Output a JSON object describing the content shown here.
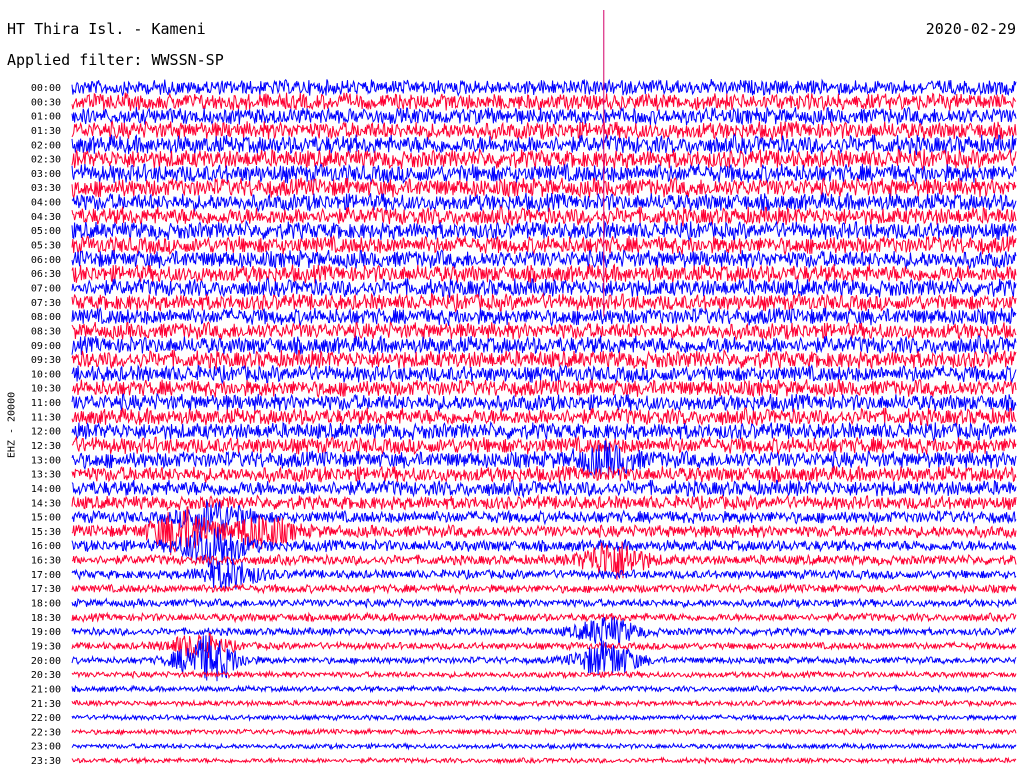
{
  "header": {
    "station": "HT Thira Isl. - Kameni",
    "date": "2020-02-29",
    "filter_label": "Applied filter: WWSSN-SP"
  },
  "colors": {
    "trace_a": "#0000ff",
    "trace_b": "#ff0033",
    "marker": "#d4006a"
  },
  "chart_data": {
    "type": "line",
    "title": "HT Thira Isl. - Kameni",
    "date": "2020-02-29",
    "filter": "WWSSN-SP",
    "ylabel": "EHZ - 20000",
    "row_labels": [
      "00:00",
      "00:30",
      "01:00",
      "01:30",
      "02:00",
      "02:30",
      "03:00",
      "03:30",
      "04:00",
      "04:30",
      "05:00",
      "05:30",
      "06:00",
      "06:30",
      "07:00",
      "07:30",
      "08:00",
      "08:30",
      "09:00",
      "09:30",
      "10:00",
      "10:30",
      "11:00",
      "11:30",
      "12:00",
      "12:30",
      "13:00",
      "13:30",
      "14:00",
      "14:30",
      "15:00",
      "15:30",
      "16:00",
      "16:30",
      "17:00",
      "17:30",
      "18:00",
      "18:30",
      "19:00",
      "19:30",
      "20:00",
      "20:30",
      "21:00",
      "21:30",
      "22:00",
      "22:30",
      "23:00",
      "23:30"
    ],
    "series_colors": [
      "#0000ff",
      "#ff0033"
    ],
    "minutes_per_row": 30,
    "relative_noise_amplitude": [
      0.78,
      0.85,
      0.85,
      0.9,
      0.95,
      0.95,
      0.95,
      0.95,
      0.9,
      0.9,
      0.9,
      0.9,
      0.9,
      0.9,
      0.9,
      0.85,
      0.85,
      0.85,
      0.9,
      0.9,
      0.85,
      0.85,
      0.85,
      0.85,
      0.85,
      0.85,
      0.85,
      0.8,
      0.8,
      0.7,
      0.62,
      0.62,
      0.58,
      0.5,
      0.45,
      0.42,
      0.4,
      0.4,
      0.38,
      0.36,
      0.34,
      0.3,
      0.28,
      0.27,
      0.26,
      0.26,
      0.25,
      0.25
    ],
    "events": [
      {
        "row": 30,
        "minute": 4.5,
        "amp": 1.1
      },
      {
        "row": 31,
        "minute": 3.5,
        "amp": 1.5
      },
      {
        "row": 31,
        "minute": 6.0,
        "amp": 1.0
      },
      {
        "row": 32,
        "minute": 4.5,
        "amp": 1.4
      },
      {
        "row": 34,
        "minute": 5.0,
        "amp": 0.9
      },
      {
        "row": 39,
        "minute": 4.0,
        "amp": 0.8
      },
      {
        "row": 40,
        "minute": 4.3,
        "amp": 1.6
      },
      {
        "row": 40,
        "minute": 17.0,
        "amp": 1.2
      },
      {
        "row": 38,
        "minute": 17.0,
        "amp": 0.9
      },
      {
        "row": 26,
        "minute": 17.0,
        "amp": 0.8
      },
      {
        "row": 33,
        "minute": 17.2,
        "amp": 1.3
      }
    ],
    "spike": {
      "minute": 16.9,
      "color": "#d4006a"
    }
  }
}
